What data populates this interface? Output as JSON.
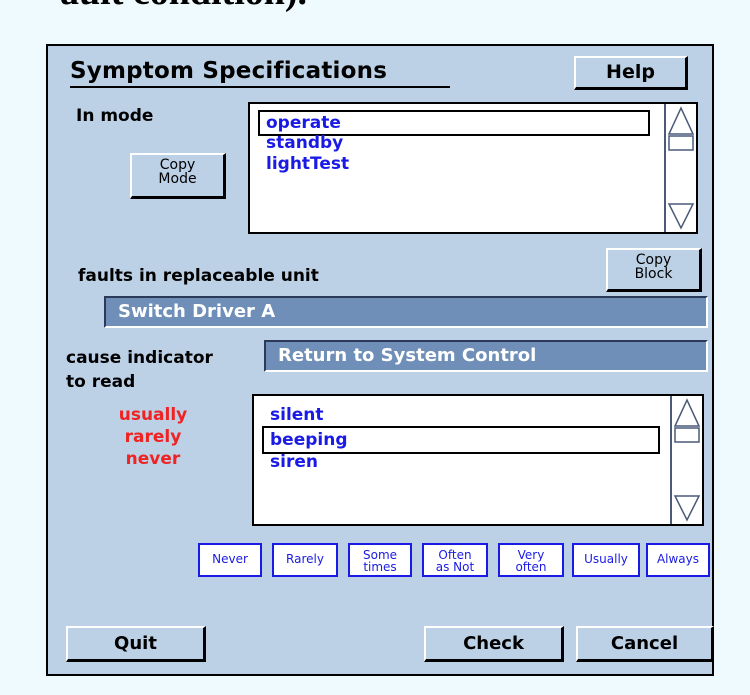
{
  "caption": "ault condition).",
  "dialog": {
    "title": "Symptom Specifications",
    "help_label": "Help",
    "mode_label": "In mode",
    "copy_mode_label": [
      "Copy",
      "Mode"
    ],
    "modes": [
      "operate",
      "standby",
      "lightTest"
    ],
    "selected_mode": "operate",
    "copy_block_label": [
      "Copy",
      "Block"
    ],
    "unit_label": "faults in replaceable unit",
    "unit_value": "Switch Driver A",
    "cause_label": "cause indicator",
    "cause_value": "Return to System Control",
    "read_label": "to read",
    "frequencies": [
      "usually",
      "rarely",
      "never"
    ],
    "readings": [
      "silent",
      "beeping",
      "siren"
    ],
    "selected_reading": "beeping",
    "freq_buttons": [
      [
        "Never"
      ],
      [
        "Rarely"
      ],
      [
        "Some",
        "times"
      ],
      [
        "Often",
        "as Not"
      ],
      [
        "Very",
        "often"
      ],
      [
        "Usually"
      ],
      [
        "Always"
      ]
    ],
    "quit_label": "Quit",
    "check_label": "Check",
    "cancel_label": "Cancel"
  },
  "colors": {
    "panel": "#bcd0e6",
    "list_text": "#1a1ae6",
    "freq_text": "#f02222",
    "field": "#6f8fb8"
  }
}
